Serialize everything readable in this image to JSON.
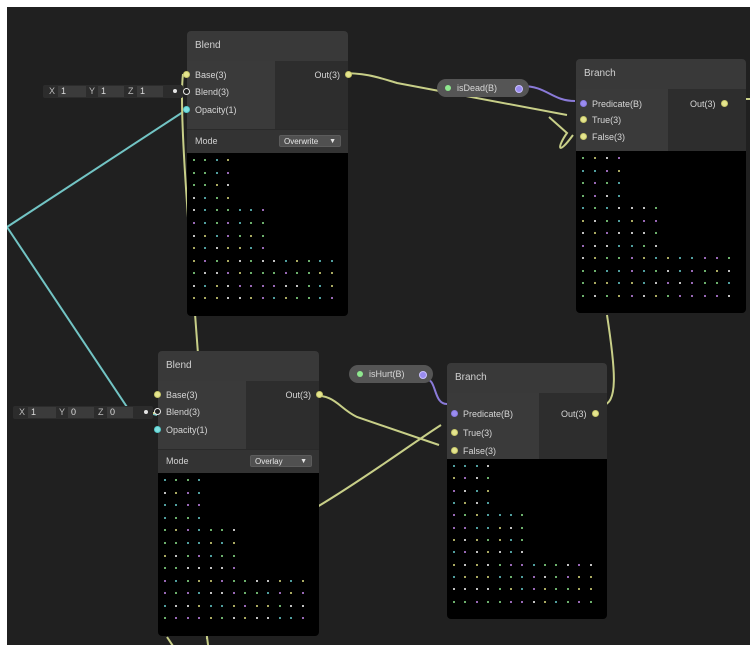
{
  "nodes": {
    "blend_top": {
      "title": "Blend",
      "inputs": [
        {
          "label": "Base(3)",
          "kind": "yellow"
        },
        {
          "label": "Blend(3)",
          "kind": "white"
        },
        {
          "label": "Opacity(1)",
          "kind": "cyan"
        }
      ],
      "output": "Out(3)",
      "mode_label": "Mode",
      "mode_value": "Overwrite"
    },
    "blend_bottom": {
      "title": "Blend",
      "inputs": [
        {
          "label": "Base(3)",
          "kind": "yellow"
        },
        {
          "label": "Blend(3)",
          "kind": "white"
        },
        {
          "label": "Opacity(1)",
          "kind": "cyan"
        }
      ],
      "output": "Out(3)",
      "mode_label": "Mode",
      "mode_value": "Overlay"
    },
    "branch_top": {
      "title": "Branch",
      "inputs": [
        {
          "label": "Predicate(B)",
          "kind": "purple"
        },
        {
          "label": "True(3)",
          "kind": "yellow"
        },
        {
          "label": "False(3)",
          "kind": "yellow"
        }
      ],
      "output": "Out(3)"
    },
    "branch_bottom": {
      "title": "Branch",
      "inputs": [
        {
          "label": "Predicate(B)",
          "kind": "purple"
        },
        {
          "label": "True(3)",
          "kind": "yellow"
        },
        {
          "label": "False(3)",
          "kind": "yellow"
        }
      ],
      "output": "Out(3)"
    }
  },
  "properties": {
    "is_dead": {
      "label": "isDead(B)"
    },
    "is_hurt": {
      "label": "isHurt(B)"
    }
  },
  "vector_inputs": {
    "top": {
      "x_label": "X",
      "x": "1",
      "y_label": "Y",
      "y": "1",
      "z_label": "Z",
      "z": "1"
    },
    "bottom": {
      "x_label": "X",
      "x": "1",
      "y_label": "Y",
      "y": "0",
      "z_label": "Z",
      "z": "0"
    }
  },
  "colors": {
    "canvas": "#202020",
    "wire_vector3": "#c8cf88",
    "wire_float": "#72c4c4",
    "wire_bool": "#8a7ad8",
    "node_header": "#393939",
    "preview": "#000000"
  }
}
